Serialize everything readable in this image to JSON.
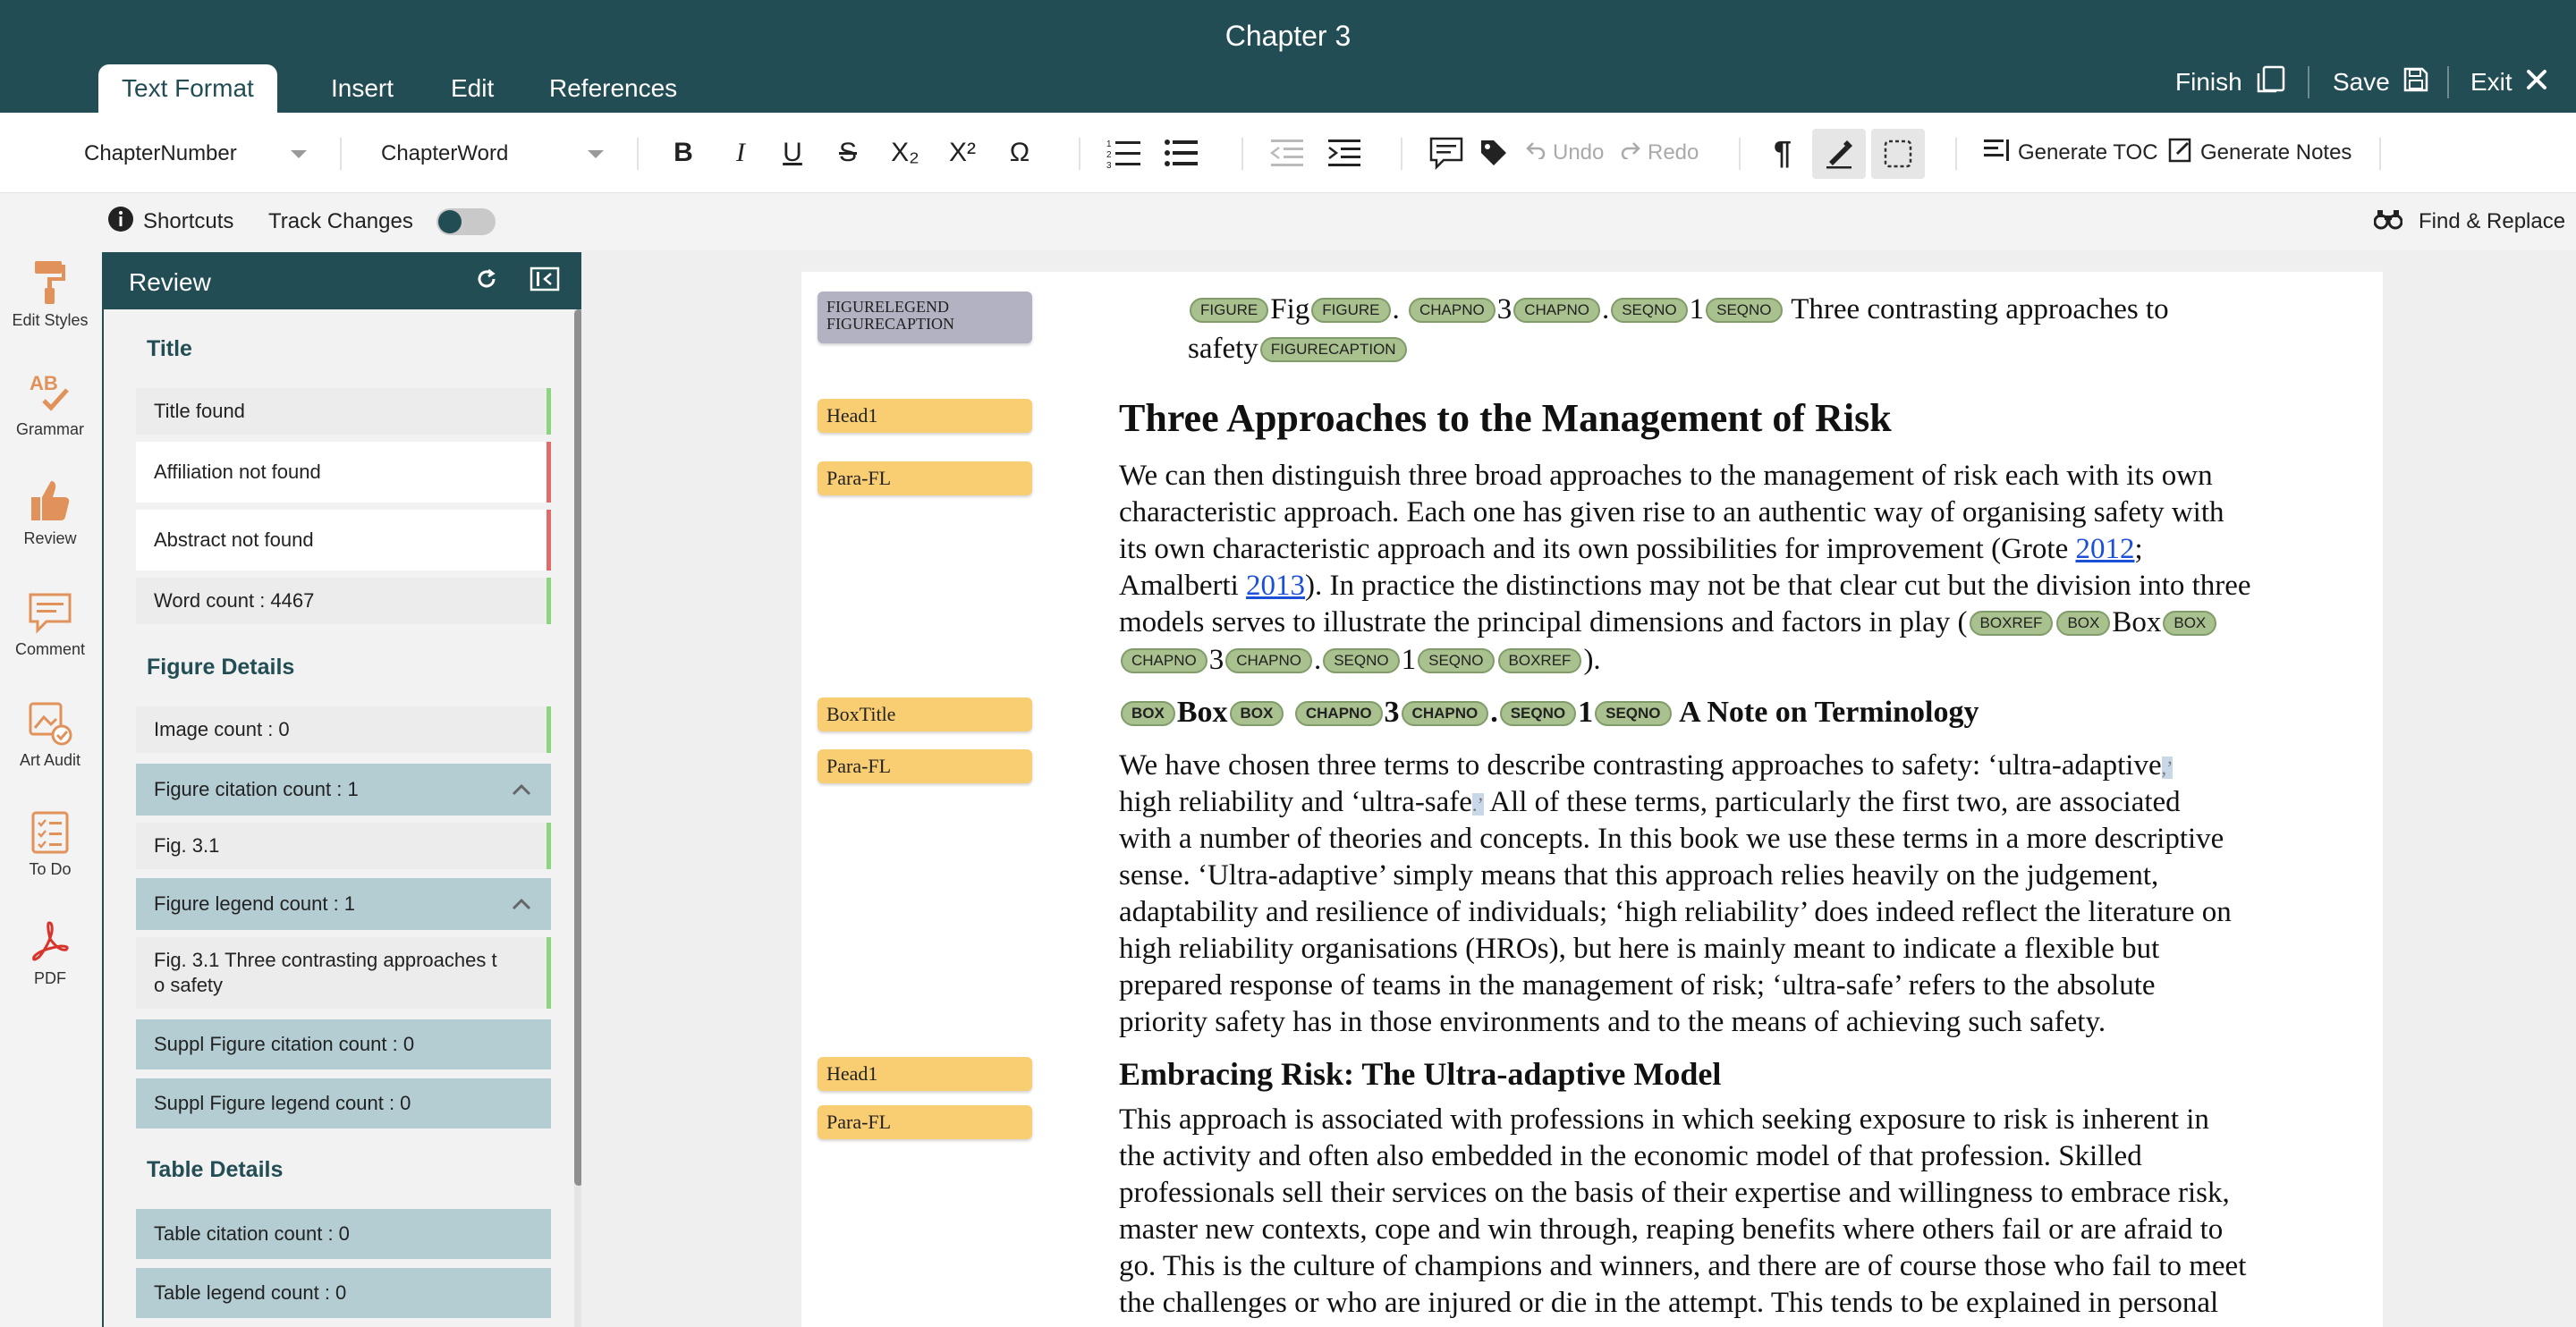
{
  "header": {
    "title": "Chapter 3",
    "tabs": [
      "Text Format",
      "Insert",
      "Edit",
      "References"
    ],
    "finish_label": "Finish",
    "save_label": "Save",
    "exit_label": "Exit"
  },
  "toolbar": {
    "style_select": "ChapterNumber",
    "word_select": "ChapterWord",
    "bold": "B",
    "italic": "I",
    "underline": "U",
    "strike": "S",
    "subscript": "X₂",
    "superscript": "X²",
    "omega": "Ω",
    "undo_label": "Undo",
    "redo_label": "Redo",
    "pilcrow": "¶",
    "generate_toc_label": "Generate TOC",
    "generate_notes_label": "Generate Notes"
  },
  "subbar": {
    "shortcuts_label": "Shortcuts",
    "track_changes_label": "Track Changes",
    "track_changes_on": false,
    "find_replace_label": "Find & Replace"
  },
  "rail": [
    "Edit Styles",
    "Grammar",
    "Review",
    "Comment",
    "Art Audit",
    "To Do",
    "PDF"
  ],
  "review": {
    "title": "Review",
    "sections": {
      "title_section": "Title",
      "figure_section": "Figure Details",
      "table_section": "Table Details"
    },
    "items": {
      "title_found": "Title found",
      "affiliation": "Affiliation not found",
      "abstract": "Abstract not found",
      "word_count": "Word count : 4467",
      "image_count": "Image count : 0",
      "figure_citation": "Figure citation count : 1",
      "fig_3_1": "Fig. 3.1",
      "figure_legend": "Figure legend count : 1",
      "fig_legend_text_1": "Fig. 3.1 Three contrasting approaches t",
      "fig_legend_text_2": "o safety",
      "suppl_citation": "Suppl Figure citation count : 0",
      "suppl_legend": "Suppl Figure legend count : 0",
      "table_citation": "Table citation count : 0",
      "table_legend": "Table legend count : 0"
    }
  },
  "document": {
    "tags": {
      "figlegend_1": "FIGURELEGEND",
      "figlegend_2": "FIGURECAPTION",
      "head1_a": "Head1",
      "parafl_a": "Para-FL",
      "boxtitle": "BoxTitle",
      "parafl_b": "Para-FL",
      "head1_b": "Head1",
      "parafl_c": "Para-FL"
    },
    "pills": {
      "figure": "FIGURE",
      "chapno": "CHAPNO",
      "seqno": "SEQNO",
      "figurecaption": "FIGURECAPTION",
      "boxref": "BOXREF",
      "box": "BOX"
    },
    "caption": {
      "fig": "Fig",
      "dot": ".",
      "num3": "3",
      "num1": "1",
      "text1": "Three contrasting approaches to",
      "text2": "safety"
    },
    "heading1": "Three Approaches to the Management of Risk",
    "para1": [
      "We can then distinguish three broad approaches to the management of risk each with its own",
      "characteristic approach. Each one has given rise to an authentic way of organising safety with",
      "its own characteristic approach and its own possibilities for improvement (Grote ",
      "2012",
      ";",
      "Amalberti ",
      "2013",
      "). In practice the distinctions may not be that clear cut but the division into three",
      "models serves to illustrate the principal dimensions and factors in play ("
    ],
    "para1_box": "Box",
    "para1_3": "3",
    "para1_1": "1",
    "para1_end": ").",
    "box_title_box": "Box",
    "box_title_3": "3",
    "box_title_dot": ".",
    "box_title_1": "1",
    "box_title_text": "A Note on Terminology",
    "para2": [
      "We have chosen three terms to describe contrasting approaches to safety: ‘ultra-adaptive",
      "high reliability and ‘ultra-safe",
      " All of these terms, particularly the first two, are associated",
      "with a number of theories and concepts. In this book we use these terms in a more descriptive",
      "sense. ‘Ultra-adaptive’ simply means that this approach relies heavily on the judgement,",
      "adaptability and resilience of individuals; ‘high reliability’ does indeed reflect the literature on",
      "high reliability organisations (HROs), but here is mainly meant to indicate a flexible but",
      "prepared response of teams in the management of risk; ‘ultra-safe’ refers to the absolute",
      "priority safety has in those environments and to the means of achieving such safety."
    ],
    "para2_mark1": ",’",
    "para2_mark2": ".’",
    "heading2": "Embracing Risk: The Ultra-adaptive Model",
    "para3": [
      "This approach is associated with professions in which seeking exposure to risk is inherent in",
      "the activity and often also embedded in the economic model of that profession. Skilled",
      "professionals sell their services on the basis of their expertise and willingness to embrace risk,",
      "master new contexts, cope and win through, reaping benefits where others fail or are afraid to",
      "go. This is the culture of champions and winners, and there are of course those who fail to meet",
      "the challenges or who are injured or die in the attempt. This tends to be explained in personal"
    ]
  },
  "colors": {
    "brand": "#224d55",
    "tag_yellow": "#f9cd72",
    "pill_green": "#a9c08f",
    "status_ok": "#8dd47e",
    "status_missing": "#e26a6a",
    "panel_teal": "#b4cdd3"
  }
}
